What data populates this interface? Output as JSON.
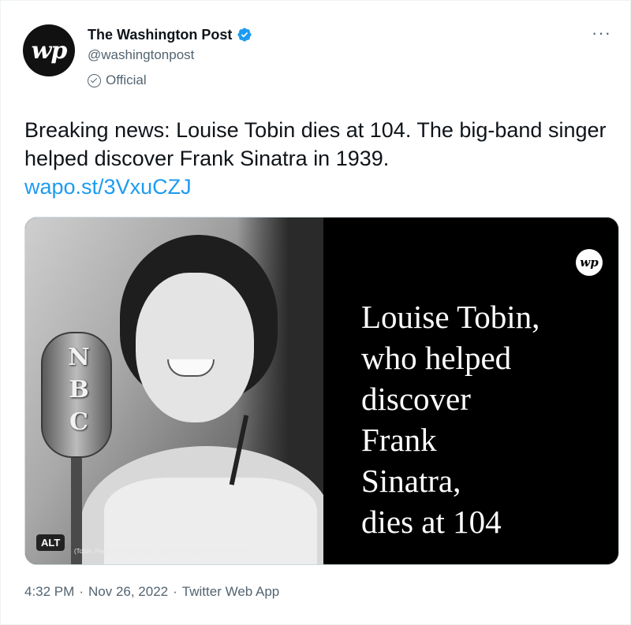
{
  "author": {
    "display_name": "The Washington Post",
    "handle": "@washingtonpost",
    "official_label": "Official",
    "avatar_text": "wp"
  },
  "tweet": {
    "text": "Breaking news: Louise Tobin dies at 104. The big-band singer helped discover Frank Sinatra in 1939.",
    "link": "wapo.st/3VxuCZJ"
  },
  "media": {
    "alt_badge": "ALT",
    "credit": "(Tobin, Peanuts Hucko Jazz Collection/Texas A&M University)",
    "mic_letters": [
      "N",
      "B",
      "C"
    ],
    "card_logo": "wp",
    "headline_lines": [
      "Louise Tobin,",
      "who helped",
      "discover",
      "Frank",
      "Sinatra,",
      "dies at 104"
    ]
  },
  "meta": {
    "time": "4:32 PM",
    "separator": "·",
    "date": "Nov 26, 2022",
    "source": "Twitter Web App"
  },
  "colors": {
    "link": "#1d9bf0",
    "verified": "#1d9bf0",
    "secondary_text": "#536471"
  },
  "icons": {
    "more": "more-horizontal-icon",
    "verified": "verified-badge-icon",
    "official": "official-check-icon"
  }
}
